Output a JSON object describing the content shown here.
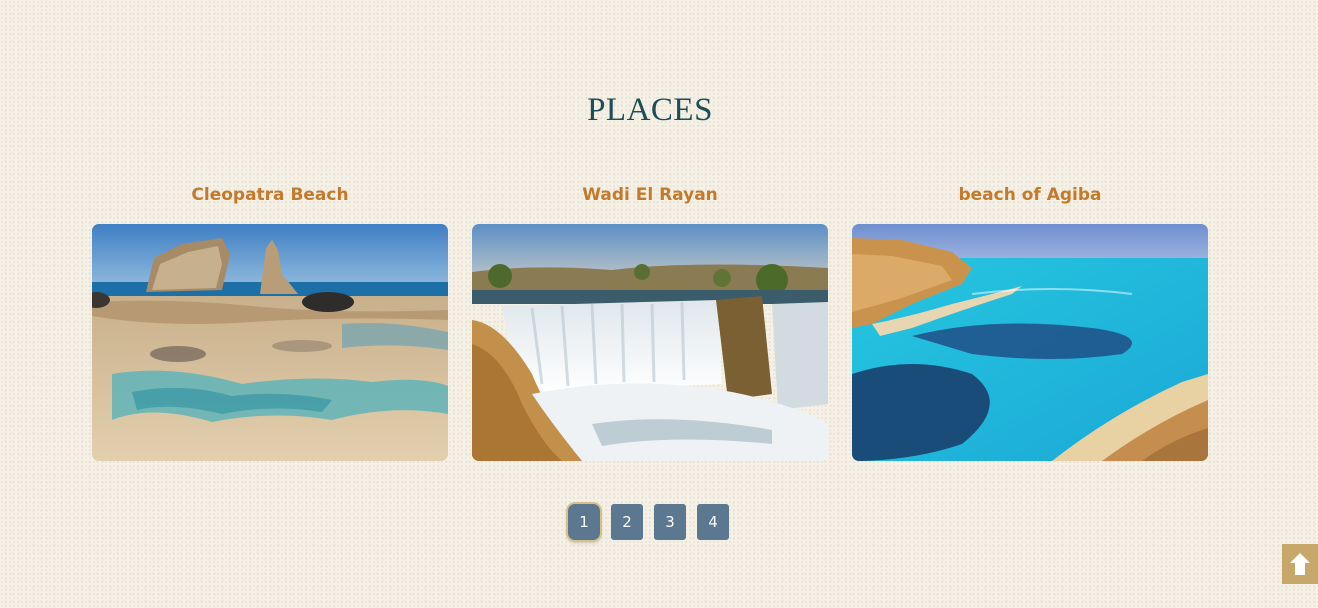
{
  "section": {
    "title": "PLACES"
  },
  "places": [
    {
      "name": "Cleopatra Beach"
    },
    {
      "name": "Wadi El Rayan"
    },
    {
      "name": "beach of Agiba"
    }
  ],
  "pagination": {
    "pages": [
      "1",
      "2",
      "3",
      "4"
    ],
    "active": "1"
  },
  "scroll_top": {
    "icon": "arrow-up-icon"
  },
  "colors": {
    "title": "#1d4d57",
    "card_title": "#c47a2c",
    "page_button": "#5b7890",
    "scroll_button": "#c8a86a",
    "background": "#f6f1e6"
  }
}
